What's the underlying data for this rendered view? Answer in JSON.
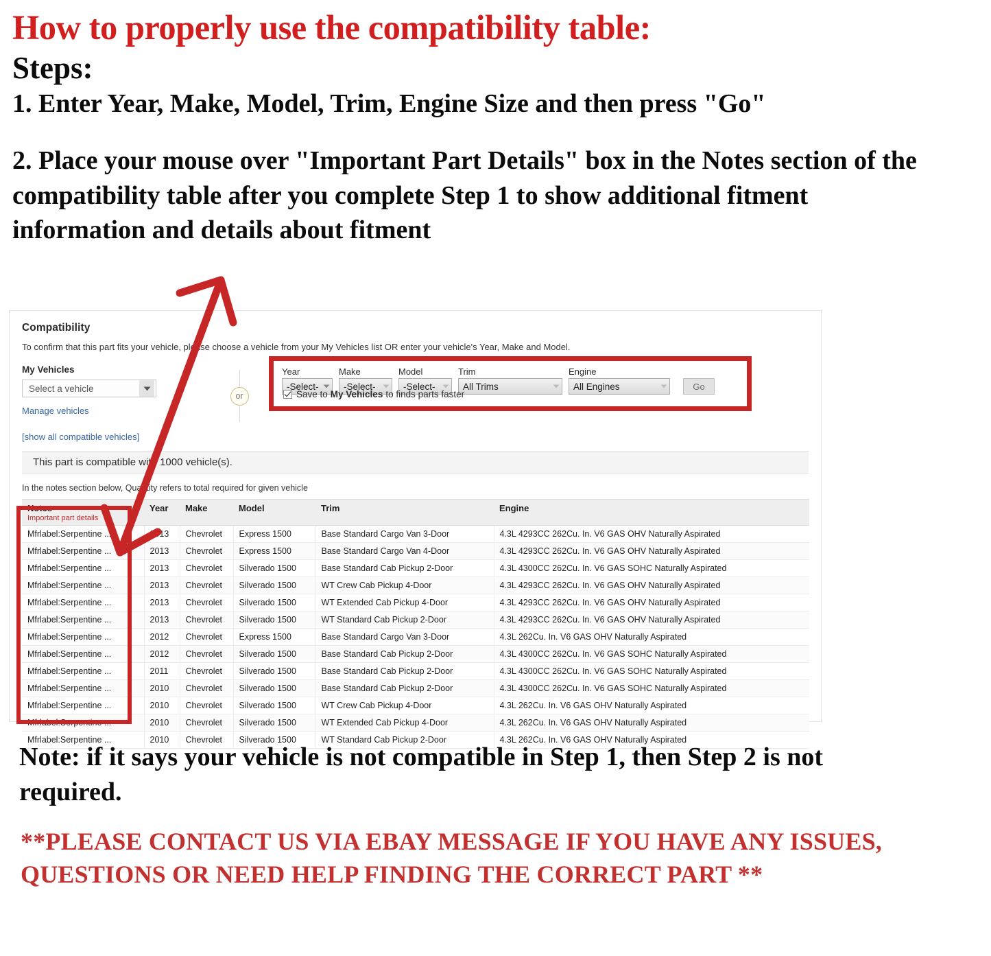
{
  "instructions": {
    "headline": "How to properly use the compatibility table:",
    "steps_title": "Steps:",
    "step_one": "1. Enter Year, Make, Model, Trim, Engine Size and then press \"Go\"",
    "step_two": "2. Place your mouse over \"Important Part Details\" box in the Notes section of the compatibility table after you complete Step 1 to show additional fitment information and details about fitment",
    "note": "Note: if it says your vehicle is not compatible in Step 1, then Step 2 is not required.",
    "contact": "**PLEASE CONTACT US VIA EBAY MESSAGE IF YOU HAVE ANY ISSUES, QUESTIONS OR NEED HELP FINDING THE CORRECT PART **"
  },
  "colors": {
    "accent_red": "#d11f1f",
    "highlight_box_red": "#c62626",
    "link_blue": "#3665a5",
    "note_red": "#c12a2a"
  },
  "compatibility": {
    "title": "Compatibility",
    "subtitle": "To confirm that this part fits your vehicle, please choose a vehicle from your My Vehicles list OR enter your vehicle's Year, Make and Model.",
    "my_vehicles": {
      "label": "My Vehicles",
      "select_value": "Select a vehicle",
      "manage_link": "Manage vehicles"
    },
    "or_label": "or",
    "picker": {
      "fields": [
        {
          "label": "Year",
          "value": "-Select-"
        },
        {
          "label": "Make",
          "value": "-Select-"
        },
        {
          "label": "Model",
          "value": "-Select-"
        },
        {
          "label": "Trim",
          "value": "All Trims"
        },
        {
          "label": "Engine",
          "value": "All Engines"
        }
      ],
      "go_label": "Go",
      "save_checkbox": {
        "checked": true,
        "text_before": "Save to",
        "text_bold": "My Vehicles",
        "text_after": "to finds parts faster"
      }
    },
    "show_all_link": "[show all compatible vehicles]",
    "compat_banner": "This part is compatible with 1000 vehicle(s).",
    "quantity_note": "In the notes section below, Quantity refers to total required for given vehicle",
    "table": {
      "headers": [
        {
          "label": "Notes",
          "sub": "Important part details"
        },
        {
          "label": "Year",
          "sub": ""
        },
        {
          "label": "Make",
          "sub": ""
        },
        {
          "label": "Model",
          "sub": ""
        },
        {
          "label": "Trim",
          "sub": ""
        },
        {
          "label": "Engine",
          "sub": ""
        }
      ],
      "rows": [
        [
          "Mfrlabel:Serpentine ...",
          "2013",
          "Chevrolet",
          "Express 1500",
          "Base Standard Cargo Van 3-Door",
          "4.3L 4293CC 262Cu. In. V6 GAS OHV Naturally Aspirated"
        ],
        [
          "Mfrlabel:Serpentine ...",
          "2013",
          "Chevrolet",
          "Express 1500",
          "Base Standard Cargo Van 4-Door",
          "4.3L 4293CC 262Cu. In. V6 GAS OHV Naturally Aspirated"
        ],
        [
          "Mfrlabel:Serpentine ...",
          "2013",
          "Chevrolet",
          "Silverado 1500",
          "Base Standard Cab Pickup 2-Door",
          "4.3L 4300CC 262Cu. In. V6 GAS SOHC Naturally Aspirated"
        ],
        [
          "Mfrlabel:Serpentine ...",
          "2013",
          "Chevrolet",
          "Silverado 1500",
          "WT Crew Cab Pickup 4-Door",
          "4.3L 4293CC 262Cu. In. V6 GAS OHV Naturally Aspirated"
        ],
        [
          "Mfrlabel:Serpentine ...",
          "2013",
          "Chevrolet",
          "Silverado 1500",
          "WT Extended Cab Pickup 4-Door",
          "4.3L 4293CC 262Cu. In. V6 GAS OHV Naturally Aspirated"
        ],
        [
          "Mfrlabel:Serpentine ...",
          "2013",
          "Chevrolet",
          "Silverado 1500",
          "WT Standard Cab Pickup 2-Door",
          "4.3L 4293CC 262Cu. In. V6 GAS OHV Naturally Aspirated"
        ],
        [
          "Mfrlabel:Serpentine ...",
          "2012",
          "Chevrolet",
          "Express 1500",
          "Base Standard Cargo Van 3-Door",
          "4.3L 262Cu. In. V6 GAS OHV Naturally Aspirated"
        ],
        [
          "Mfrlabel:Serpentine ...",
          "2012",
          "Chevrolet",
          "Silverado 1500",
          "Base Standard Cab Pickup 2-Door",
          "4.3L 4300CC 262Cu. In. V6 GAS SOHC Naturally Aspirated"
        ],
        [
          "Mfrlabel:Serpentine ...",
          "2011",
          "Chevrolet",
          "Silverado 1500",
          "Base Standard Cab Pickup 2-Door",
          "4.3L 4300CC 262Cu. In. V6 GAS SOHC Naturally Aspirated"
        ],
        [
          "Mfrlabel:Serpentine ...",
          "2010",
          "Chevrolet",
          "Silverado 1500",
          "Base Standard Cab Pickup 2-Door",
          "4.3L 4300CC 262Cu. In. V6 GAS SOHC Naturally Aspirated"
        ],
        [
          "Mfrlabel:Serpentine ...",
          "2010",
          "Chevrolet",
          "Silverado 1500",
          "WT Crew Cab Pickup 4-Door",
          "4.3L 262Cu. In. V6 GAS OHV Naturally Aspirated"
        ],
        [
          "Mfrlabel:Serpentine ...",
          "2010",
          "Chevrolet",
          "Silverado 1500",
          "WT Extended Cab Pickup 4-Door",
          "4.3L 262Cu. In. V6 GAS OHV Naturally Aspirated"
        ],
        [
          "Mfrlabel:Serpentine ...",
          "2010",
          "Chevrolet",
          "Silverado 1500",
          "WT Standard Cab Pickup 2-Door",
          "4.3L 262Cu. In. V6 GAS OHV Naturally Aspirated"
        ]
      ]
    }
  }
}
